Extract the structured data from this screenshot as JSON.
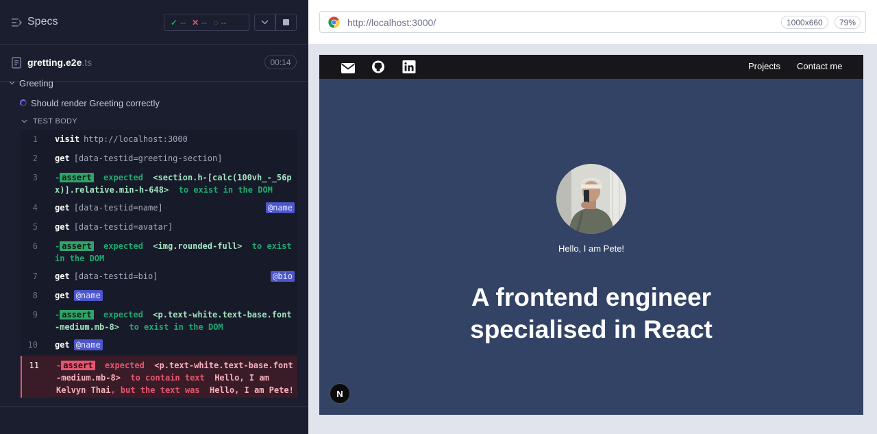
{
  "runner": {
    "title": "Specs",
    "stats": {
      "passed": "--",
      "failed": "--",
      "pending": "--"
    },
    "file": {
      "name": "gretting",
      "ext": ".e2e",
      "ext2": ".ts",
      "duration": "00:14"
    },
    "suite": "Greeting",
    "test": "Should render Greeting correctly",
    "body_label": "TEST BODY",
    "commands": [
      {
        "num": "1",
        "kw": "visit",
        "arg": "http://localhost:3000"
      },
      {
        "num": "2",
        "kw": "get",
        "arg": "[data-testid=greeting-section]"
      },
      {
        "num": "3",
        "tag": "assert",
        "expected": "expected",
        "val": "<section.h-[calc(100vh_-_56px)].relative.min-h-648>",
        "rest": "to exist in the DOM"
      },
      {
        "num": "4",
        "kw": "get",
        "arg": "[data-testid=name]",
        "alias": "@name"
      },
      {
        "num": "5",
        "kw": "get",
        "arg": "[data-testid=avatar]"
      },
      {
        "num": "6",
        "tag": "assert",
        "expected": "expected",
        "val": "<img.rounded-full>",
        "rest": "to exist in the DOM"
      },
      {
        "num": "7",
        "kw": "get",
        "arg": "[data-testid=bio]",
        "alias": "@bio"
      },
      {
        "num": "8",
        "kw": "get",
        "alias": "@name"
      },
      {
        "num": "9",
        "tag": "assert",
        "expected": "expected",
        "val": "<p.text-white.text-base.font-medium.mb-8>",
        "rest": "to exist in the DOM"
      },
      {
        "num": "10",
        "kw": "get",
        "alias": "@name"
      },
      {
        "num": "11",
        "tag": "assert",
        "expected": "expected",
        "val": "<p.text-white.text-base.font-medium.mb-8>",
        "rest": "to contain text",
        "val2": "Hello, I am Kelvyn Thai",
        "rest2": ", but the text was",
        "val3": "Hello, I am Pete!"
      }
    ]
  },
  "browser": {
    "url": "http://localhost:3000/",
    "viewport": "1000x660",
    "zoom": "79%"
  },
  "site": {
    "nav_links": [
      "Projects",
      "Contact me"
    ],
    "nav_icons": [
      "mail-icon",
      "github-icon",
      "linkedin-icon"
    ],
    "greeting": "Hello, I am Pete!",
    "headline_line1": "A frontend engineer",
    "headline_line2": "specialised in React",
    "next_badge": "N"
  },
  "colors": {
    "runner_bg": "#1b1e2e",
    "pass": "#1fa971",
    "fail": "#e45770",
    "alias": "#4c56cb",
    "site_bg": "#334365",
    "site_nav": "#17171b"
  }
}
